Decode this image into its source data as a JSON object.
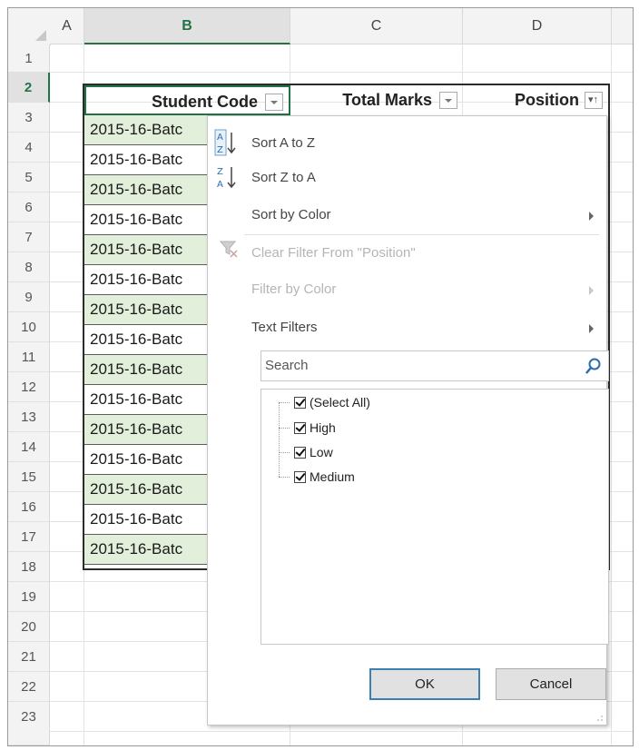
{
  "columns": [
    {
      "letter": "A"
    },
    {
      "letter": "B"
    },
    {
      "letter": "C"
    },
    {
      "letter": "D"
    }
  ],
  "rows": [
    "1",
    "2",
    "3",
    "4",
    "5",
    "6",
    "7",
    "8",
    "9",
    "10",
    "11",
    "12",
    "13",
    "14",
    "15",
    "16",
    "17",
    "18",
    "19",
    "20",
    "21",
    "22",
    "23"
  ],
  "table": {
    "headers": {
      "student_code": "Student Code",
      "total_marks": "Total Marks",
      "position": "Position"
    },
    "student_codes": [
      "2015-16-Batc",
      "2015-16-Batc",
      "2015-16-Batc",
      "2015-16-Batc",
      "2015-16-Batc",
      "2015-16-Batc",
      "2015-16-Batc",
      "2015-16-Batc",
      "2015-16-Batc",
      "2015-16-Batc",
      "2015-16-Batc",
      "2015-16-Batc",
      "2015-16-Batc",
      "2015-16-Batc",
      "2015-16-Batc"
    ]
  },
  "filter_menu": {
    "sort_a_to_z": "Sort A to Z",
    "sort_z_to_a": "Sort Z to A",
    "sort_by_color": "Sort by Color",
    "clear_filter": "Clear Filter From \"Position\"",
    "filter_by_color": "Filter by Color",
    "text_filters": "Text Filters",
    "search_placeholder": "Search",
    "items": [
      {
        "label": "(Select All)",
        "checked": true
      },
      {
        "label": "High",
        "checked": true
      },
      {
        "label": "Low",
        "checked": true
      },
      {
        "label": "Medium",
        "checked": true
      }
    ],
    "ok_label": "OK",
    "cancel_label": "Cancel"
  },
  "colors": {
    "accent_green": "#217346",
    "row_band_green": "#e2efda",
    "ok_border_blue": "#3c7fb1"
  }
}
